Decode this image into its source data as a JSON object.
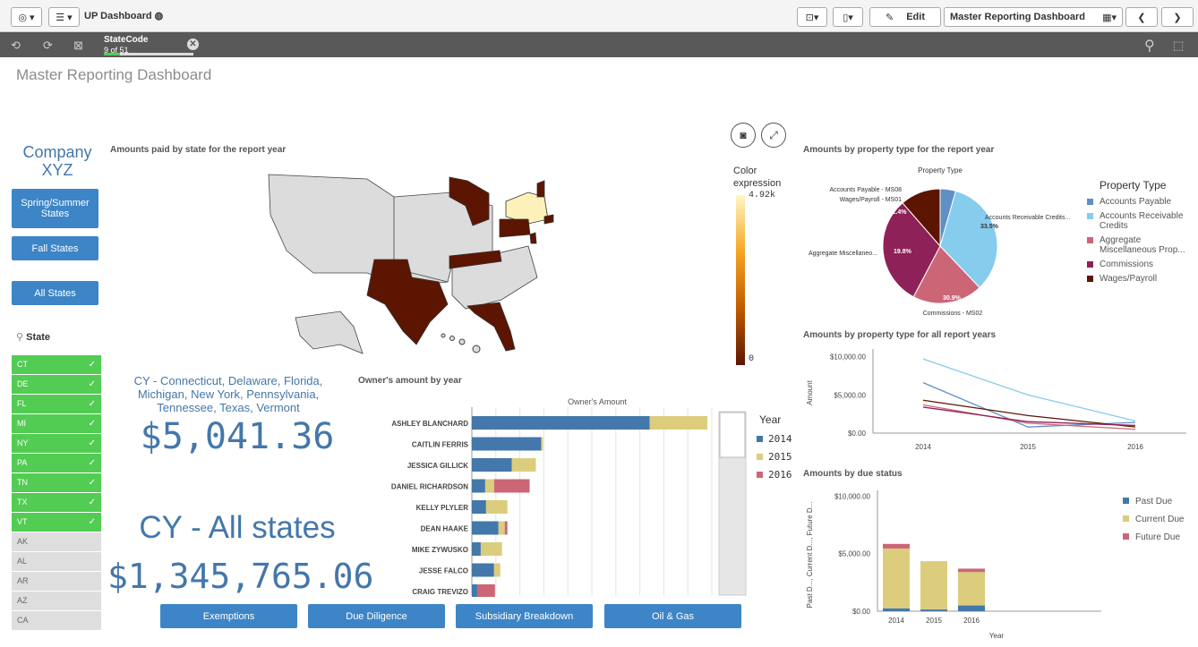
{
  "toolbar": {
    "app_title": "UP Dashboard",
    "edit_label": "Edit",
    "sheet_select": "Master Reporting Dashboard"
  },
  "selection": {
    "field": "StateCode",
    "count": "9 of 51"
  },
  "sheet": {
    "title": "Master Reporting Dashboard"
  },
  "sidebar": {
    "company": "Company XYZ",
    "buttons": [
      "Spring/Summer States",
      "Fall States",
      "All States"
    ],
    "state_label": "State",
    "states": [
      {
        "code": "CT",
        "selected": true
      },
      {
        "code": "DE",
        "selected": true
      },
      {
        "code": "FL",
        "selected": true
      },
      {
        "code": "MI",
        "selected": true
      },
      {
        "code": "NY",
        "selected": true
      },
      {
        "code": "PA",
        "selected": true
      },
      {
        "code": "TN",
        "selected": true
      },
      {
        "code": "TX",
        "selected": true
      },
      {
        "code": "VT",
        "selected": true
      },
      {
        "code": "AK",
        "selected": false
      },
      {
        "code": "AL",
        "selected": false
      },
      {
        "code": "AR",
        "selected": false
      },
      {
        "code": "AZ",
        "selected": false
      },
      {
        "code": "CA",
        "selected": false
      }
    ]
  },
  "map_panel": {
    "title": "Amounts paid by state for the report year",
    "legend_title": "Color expression",
    "legend_max": "4.92k",
    "legend_min": "0"
  },
  "kpi": {
    "selected_states_text": "CY - Connecticut, Delaware, Florida, Michigan, New York, Pennsylvania, Tennessee, Texas, Vermont",
    "selected_amount": "$5,041.36",
    "all_label": "CY - All states",
    "all_amount": "$1,345,765.06"
  },
  "owners_panel": {
    "title": "Owner's amount by year",
    "chart_title": "Owner's Amount",
    "legend_title": "Year",
    "names": [
      "ASHLEY BLANCHARD",
      "CAITLIN FERRIS",
      "JESSICA GILLICK",
      "DANIEL RICHARDSON",
      "KELLY PLYLER",
      "DEAN HAAKE",
      "MIKE ZYWUSKO",
      "JESSE FALCO",
      "CRAIG TREVIZO"
    ]
  },
  "bottom_buttons": [
    "Exemptions",
    "Due Diligence",
    "Subsidiary Breakdown",
    "Oil & Gas"
  ],
  "pie_panel": {
    "title": "Amounts by property type for the report year",
    "chart_title": "Property Type",
    "legend_title": "Property Type",
    "labels": [
      "Accounts Payable - MS08",
      "Wages/Payroll - MS01",
      "Accounts Receivable Credits...",
      "Aggregate Miscellaneo...",
      "Commissions - MS02"
    ],
    "pct_labels": [
      "11.4%",
      "33.5%",
      "19.8%",
      "30.9%"
    ]
  },
  "line_panel": {
    "title": "Amounts by property type for all report years",
    "ylabel": "Amount"
  },
  "due_panel": {
    "title": "Amounts by due status",
    "ylabel": "Past D..., Current D..., Future D...",
    "xlabel": "Year"
  },
  "colors": {
    "accent": "#3d85c6",
    "selected_green": "#52cc52",
    "year_2014": "#4477aa",
    "year_2015": "#dccd7d",
    "year_2016": "#cc6677",
    "accounts_payable": "#5f8fc5",
    "accounts_receivable": "#86ccec",
    "aggregate_misc": "#cc6677",
    "commissions": "#8e2157",
    "wages_payroll": "#5c1500"
  },
  "chart_data": [
    {
      "type": "bar",
      "orientation": "horizontal",
      "stacked": true,
      "title": "Owner's Amount",
      "categories": [
        "ASHLEY BLANCHARD",
        "CAITLIN FERRIS",
        "JESSICA GILLICK",
        "DANIEL RICHARDSON",
        "KELLY PLYLER",
        "DEAN HAAKE",
        "MIKE ZYWUSKO",
        "JESSE FALCO",
        "CRAIG TREVIZO"
      ],
      "series": [
        {
          "name": "2014",
          "values": [
            200,
            78,
            45,
            15,
            16,
            30,
            10,
            25,
            6
          ]
        },
        {
          "name": "2015",
          "values": [
            65,
            2,
            27,
            10,
            24,
            7,
            24,
            7,
            0
          ]
        },
        {
          "name": "2016",
          "values": [
            0,
            0,
            0,
            40,
            0,
            3,
            0,
            0,
            20
          ]
        }
      ],
      "legend": "right"
    },
    {
      "type": "pie",
      "title": "Property Type",
      "categories": [
        "Accounts Payable",
        "Accounts Receivable Credits",
        "Aggregate Miscellaneous Prop...",
        "Commissions",
        "Wages/Payroll"
      ],
      "values": [
        4.4,
        33.5,
        19.8,
        30.9,
        11.4
      ],
      "legend": "right"
    },
    {
      "type": "line",
      "x": [
        2014,
        2015,
        2016
      ],
      "ylabel": "Amount",
      "yticks": [
        "$10,000.00",
        "$5,000.00",
        "$0.00"
      ],
      "ylim": [
        0,
        11000
      ],
      "series": [
        {
          "color": "#86ccec",
          "values": [
            9700,
            5000,
            1600
          ]
        },
        {
          "color": "#5f8fc5",
          "values": [
            6600,
            800,
            1400
          ]
        },
        {
          "color": "#5c1500",
          "values": [
            4300,
            2300,
            800
          ]
        },
        {
          "color": "#cc6677",
          "values": [
            3700,
            1300,
            500
          ]
        },
        {
          "color": "#8e2157",
          "values": [
            3400,
            1500,
            1000
          ]
        }
      ]
    },
    {
      "type": "bar",
      "stacked": true,
      "categories": [
        "2014",
        "2015",
        "2016"
      ],
      "xlabel": "Year",
      "ylabel": "Past D..., Current D..., Future D...",
      "yticks": [
        "$10,000.00",
        "$5,000.00",
        "$0.00"
      ],
      "ylim": [
        0,
        10500
      ],
      "series": [
        {
          "name": "Past Due",
          "values": [
            250,
            150,
            500
          ]
        },
        {
          "name": "Current Due",
          "values": [
            5200,
            4200,
            2900
          ]
        },
        {
          "name": "Future Due",
          "values": [
            400,
            0,
            300
          ]
        }
      ],
      "legend": "right"
    }
  ]
}
